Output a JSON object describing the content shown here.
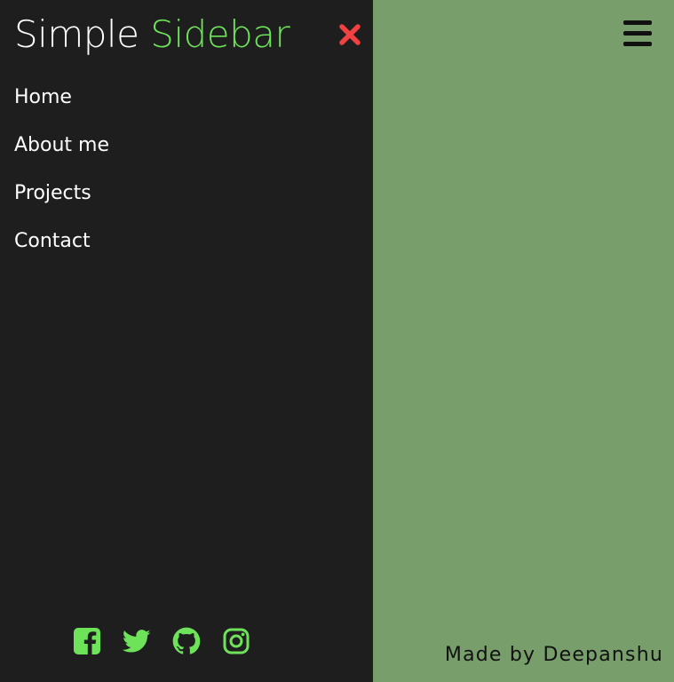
{
  "sidebar": {
    "brand": {
      "word1": "Simple",
      "word2": "Sidebar"
    },
    "close_icon": "close-icon",
    "nav": [
      {
        "label": "Home"
      },
      {
        "label": "About me"
      },
      {
        "label": "Projects"
      },
      {
        "label": "Contact"
      }
    ],
    "socials": [
      {
        "icon": "facebook-icon"
      },
      {
        "icon": "twitter-icon"
      },
      {
        "icon": "github-icon"
      },
      {
        "icon": "instagram-icon"
      }
    ]
  },
  "main": {
    "menu_icon": "hamburger-menu-icon",
    "credit": "Made by Deepanshu"
  },
  "colors": {
    "sidebar_bg": "#1e1e1e",
    "main_bg": "#779e6b",
    "accent_green": "#6ee35a",
    "close_red": "#f24141",
    "text_light": "#ffffff",
    "text_dark": "#111111"
  }
}
